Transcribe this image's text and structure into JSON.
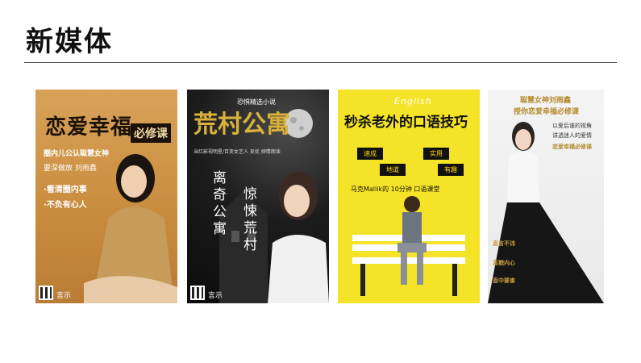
{
  "page": {
    "title": "新媒体"
  },
  "posters": [
    {
      "title": "恋爱幸福",
      "badge": "必修课",
      "lines": [
        "圈内儿公认聪慧女神",
        "要深做放 刘雨鑫",
        "·看清圈内事",
        "·不负有心人"
      ],
      "logo": "言示"
    },
    {
      "top_label": "恐惧精选小说",
      "title": "荒村公寓",
      "subtitle": "当红影视明星/百变女艺人 吴优 倾情朗读",
      "vertical_1": "离奇公寓",
      "vertical_2": "惊悚荒村",
      "logo": "言示"
    },
    {
      "english": "English",
      "title": "秒杀老外的口语技巧",
      "tags": [
        "速成",
        "实用",
        "地道",
        "有趣"
      ],
      "line": "马克Mallik的 10分钟 口语课堂"
    },
    {
      "title_lines": [
        "聪慧女神刘雨鑫",
        "授你恋爱幸福必修课"
      ],
      "right_lines": [
        "以爱后谁的视角",
        "讲透迷人的爱情",
        "恋爱幸福必修课"
      ],
      "sections": [
        "直言不讳",
        "直戳内心",
        "直中要害"
      ]
    }
  ]
}
